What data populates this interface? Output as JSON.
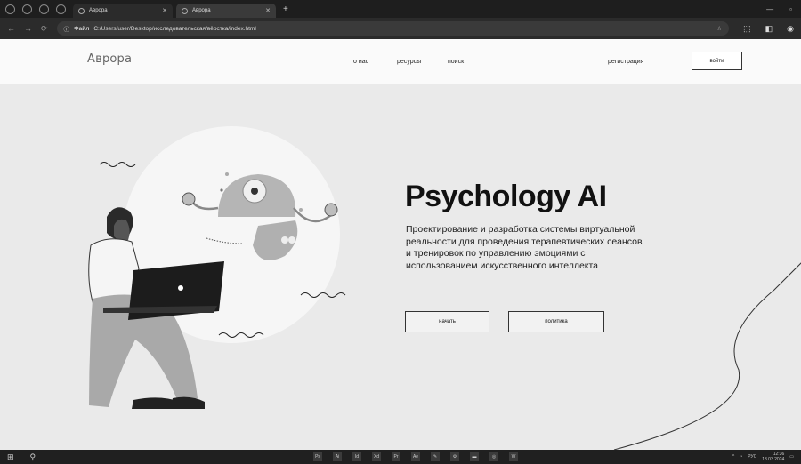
{
  "browser": {
    "tabs": [
      {
        "title": "Аврора",
        "active": false
      },
      {
        "title": "Аврора",
        "active": true
      }
    ],
    "new_tab_label": "+",
    "address": {
      "scheme": "Файл",
      "path": "C:/Users/user/Desktop/исследовательская/вёрстка/index.html"
    }
  },
  "site": {
    "logo": "Аврора",
    "nav": {
      "about": "о нас",
      "resources": "ресурсы",
      "search": "поиск",
      "register": "регистрация",
      "login": "войти"
    },
    "hero": {
      "title": "Psychology AI",
      "description": "Проектирование и разработка системы виртуальной реальности для проведения терапевтических сеансов и тренировок по управлению эмоциями с использованием искусственного интеллекта",
      "start_button": "начать",
      "policy_button": "политика"
    }
  },
  "taskbar": {
    "apps": [
      "Ps",
      "Ai",
      "Id",
      "Xd",
      "Pr",
      "Ae"
    ],
    "tray_lang": "РУС",
    "time": "12:36",
    "date": "13.03.2024"
  },
  "colors": {
    "page_bg": "#eaeaea",
    "header_bg": "#fafafa",
    "accent_dark": "#111111",
    "browser_chrome": "#2b2b2b"
  }
}
